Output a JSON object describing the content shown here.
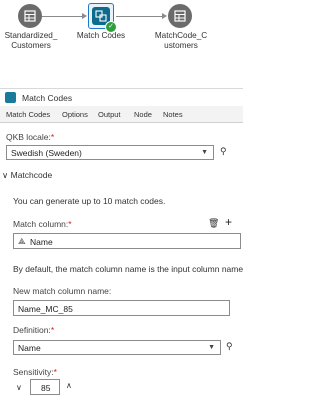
{
  "flow": {
    "nodes": [
      {
        "label_lines": [
          "Standardized_",
          "Customers"
        ]
      },
      {
        "label_lines": [
          "Match Codes"
        ]
      },
      {
        "label_lines": [
          "MatchCode_C",
          "ustomers"
        ]
      }
    ]
  },
  "panel": {
    "title": "Match Codes"
  },
  "tabs": [
    "Match Codes",
    "Options",
    "Output",
    "Node",
    "Notes"
  ],
  "qkb": {
    "label": "QKB locale:",
    "required_mark": "*",
    "value": "Swedish (Sweden)"
  },
  "matchcode": {
    "section_label": "Matchcode",
    "info": "You can generate up to 10 match codes.",
    "match_column_label": "Match column:",
    "match_column_value": "Name",
    "default_note": "By default, the match column name is the input column name pl",
    "new_name_label": "New match column name:",
    "new_name_value": "Name_MC_85",
    "definition_label": "Definition:",
    "definition_value": "Name",
    "sensitivity_label": "Sensitivity:",
    "sensitivity_value": "85"
  },
  "icons": {
    "binoculars": "binoculars-icon",
    "trash": "trash-icon",
    "plus": "plus-icon"
  },
  "colors": {
    "accent": "#1f78c8",
    "node": "#6b6b6b",
    "selected_node": "#0f6b8c",
    "success": "#2e9e3a",
    "required": "#c41e1e"
  }
}
